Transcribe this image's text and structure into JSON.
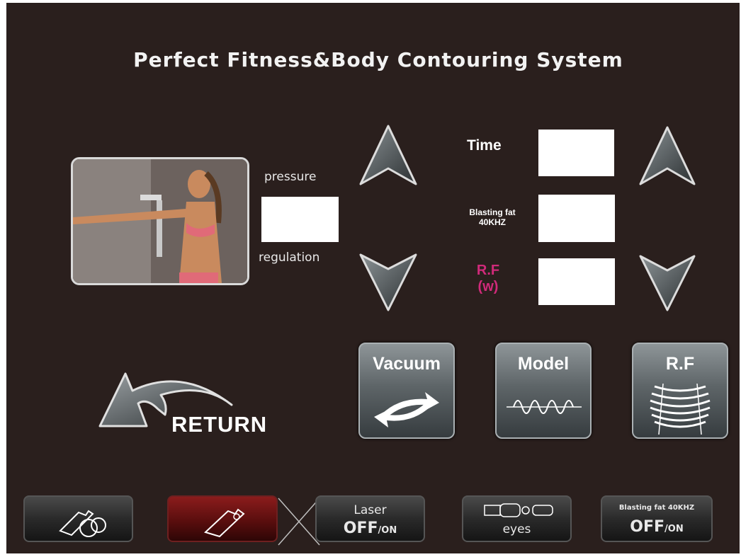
{
  "title": "Perfect Fitness&Body Contouring System",
  "pressure": {
    "label_top": "pressure",
    "label_bottom": "regulation",
    "value": ""
  },
  "settings": {
    "time_label": "Time",
    "time_value": "",
    "blasting_label_1": "Blasting fat",
    "blasting_label_2": "40KHZ",
    "blasting_value": "",
    "rf_label_1": "R.F",
    "rf_label_2": "(w)",
    "rf_value": "",
    "rf_label_color": "#d02a7a"
  },
  "buttons": {
    "vacuum": "Vacuum",
    "model": "Model",
    "rf": "R.F",
    "return": "RETURN"
  },
  "toolbar": {
    "laser_label": "Laser",
    "laser_state": "OFF",
    "laser_state_small": "/ON",
    "eyes_label": "eyes",
    "blasting_label": "Blasting fat 40KHZ",
    "blasting_state": "OFF",
    "blasting_state_small": "/ON"
  },
  "icons": {
    "photo": "woman-with-handpiece-photo",
    "up": "up-arrow-icon",
    "down": "down-arrow-icon",
    "vacuum": "vacuum-cycle-icon",
    "model": "sine-wave-icon",
    "rf": "rf-waves-icon",
    "return": "return-arrow-icon"
  }
}
